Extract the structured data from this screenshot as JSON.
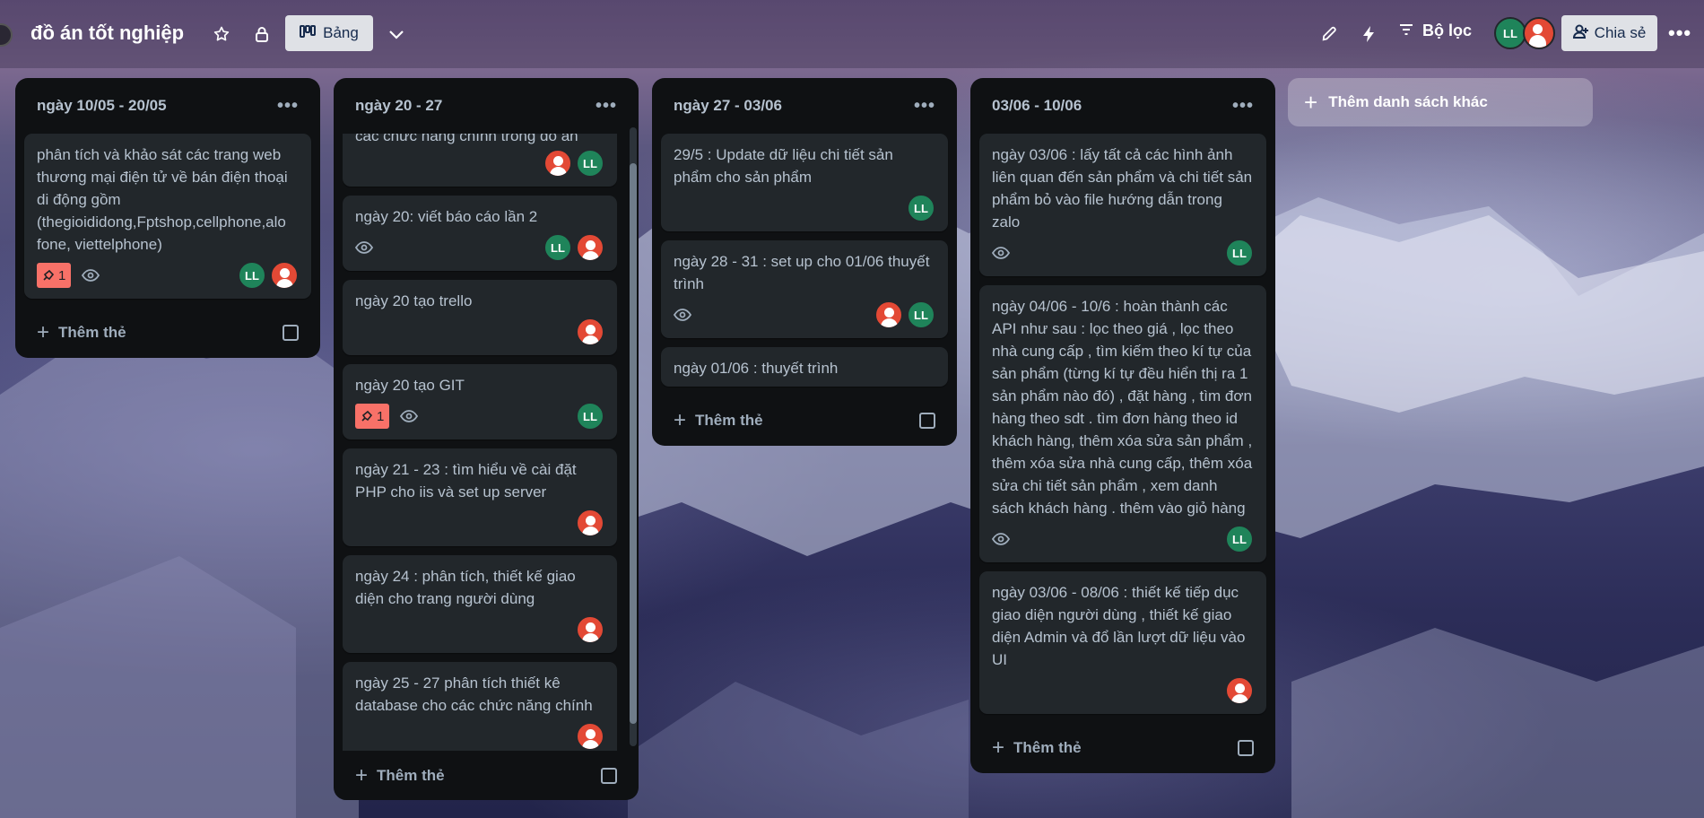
{
  "header": {
    "board_title": "đồ án tốt nghiệp",
    "view_label": "Bảng",
    "filter_label": "Bộ lọc",
    "share_label": "Chia sẻ",
    "member_initials": "LL",
    "more_label": "•••"
  },
  "lists": [
    {
      "title": "ngày 10/05 - 20/05",
      "add_label": "Thêm thẻ",
      "cards": [
        {
          "text": "phân tích và khảo sát các trang web thương mại điện tử về bán điện thoại di động gồm (thegioididong,Fptshop,cellphone,alo fone, viettelphone)",
          "votes": "1"
        }
      ]
    },
    {
      "title": "ngày 20 - 27",
      "add_label": "Thêm thẻ",
      "cards": [
        {
          "text": "các chức năng chính trong đồ án"
        },
        {
          "text": "ngày 20: viết báo cáo lần 2"
        },
        {
          "text": "ngày 20 tạo trello"
        },
        {
          "text": "ngày 20 tạo GIT",
          "votes": "1"
        },
        {
          "text": "ngày 21 - 23 : tìm hiểu về cài đặt PHP cho iis và set up server"
        },
        {
          "text": "ngày 24 : phân tích, thiết kế giao diện cho trang người dùng"
        },
        {
          "text": "ngày 25 - 27 phân tích thiết kê database cho các chức năng chính"
        }
      ]
    },
    {
      "title": "ngày 27 - 03/06",
      "add_label": "Thêm thẻ",
      "cards": [
        {
          "text": "29/5 : Update dữ liệu chi tiết sản phẩm cho sản phẩm"
        },
        {
          "text": "ngày 28 - 31 : set up cho 01/06 thuyết trình"
        },
        {
          "text": "ngày 01/06 : thuyết trình"
        }
      ]
    },
    {
      "title": "03/06 - 10/06",
      "add_label": "Thêm thẻ",
      "cards": [
        {
          "text": "ngày 03/06 : lấy tất cả các hình ảnh liên quan đến sản phẩm và chi tiết sản phẩm bỏ vào file hướng dẫn trong zalo"
        },
        {
          "text": "ngày 04/06 - 10/6 : hoàn thành các API như sau : lọc theo giá , lọc theo nhà cung cấp , tìm kiếm theo kí tự của sản phẩm (từng kí tự đều hiển thị ra 1 sản phẩm nào đó) , đặt hàng , tìm đơn hàng theo sdt . tìm đơn hàng theo id khách hàng, thêm xóa sửa sản phẩm , thêm xóa sửa nhà cung cấp, thêm xóa sửa chi tiết sản phẩm , xem danh sách khách hàng . thêm vào giỏ hàng"
        },
        {
          "text": "ngày 03/06 - 08/06 : thiết kế tiếp dục giao diện người dùng , thiết kế giao diện Admin và đổ lần lượt dữ liệu vào UI"
        }
      ]
    }
  ],
  "add_list_label": "Thêm danh sách khác",
  "colors": {
    "list_bg": "#0f1113",
    "card_bg": "#22272b",
    "vote_badge": "#f87168",
    "member_green": "#1f845a",
    "member_red": "#e34935"
  }
}
